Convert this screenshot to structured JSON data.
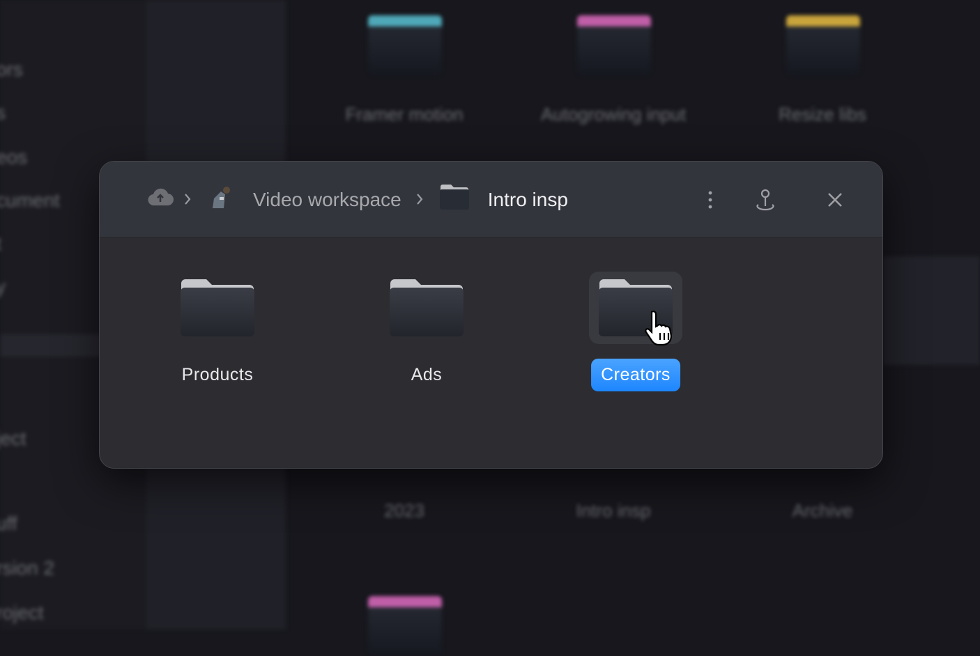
{
  "background": {
    "sidebar_items": [
      "ors",
      "s",
      "eos",
      "cument",
      "t",
      "y",
      "ject",
      "uff",
      "rsion 2",
      "roject"
    ],
    "folders": [
      {
        "label": "Framer motion",
        "color": "#4fa8b8"
      },
      {
        "label": "Autogrowing input",
        "color": "#c05fa8"
      },
      {
        "label": "Resize libs",
        "color": "#c9a43c"
      },
      {
        "label": "2023",
        "color": ""
      },
      {
        "label": "Intro insp",
        "color": ""
      },
      {
        "label": "Archive",
        "color": ""
      }
    ]
  },
  "dialog": {
    "breadcrumb": [
      {
        "label": "",
        "icon": "cloud-upload-icon"
      },
      {
        "label": "Video workspace",
        "icon": "workspace-icon"
      },
      {
        "label": "Intro insp",
        "icon": "folder-icon"
      }
    ],
    "actions": [
      "more-vertical-icon",
      "pin-icon",
      "close-icon"
    ],
    "items": [
      {
        "label": "Products",
        "selected": false
      },
      {
        "label": "Ads",
        "selected": false
      },
      {
        "label": "Creators",
        "selected": true
      }
    ],
    "accent": "#1e86ff"
  }
}
